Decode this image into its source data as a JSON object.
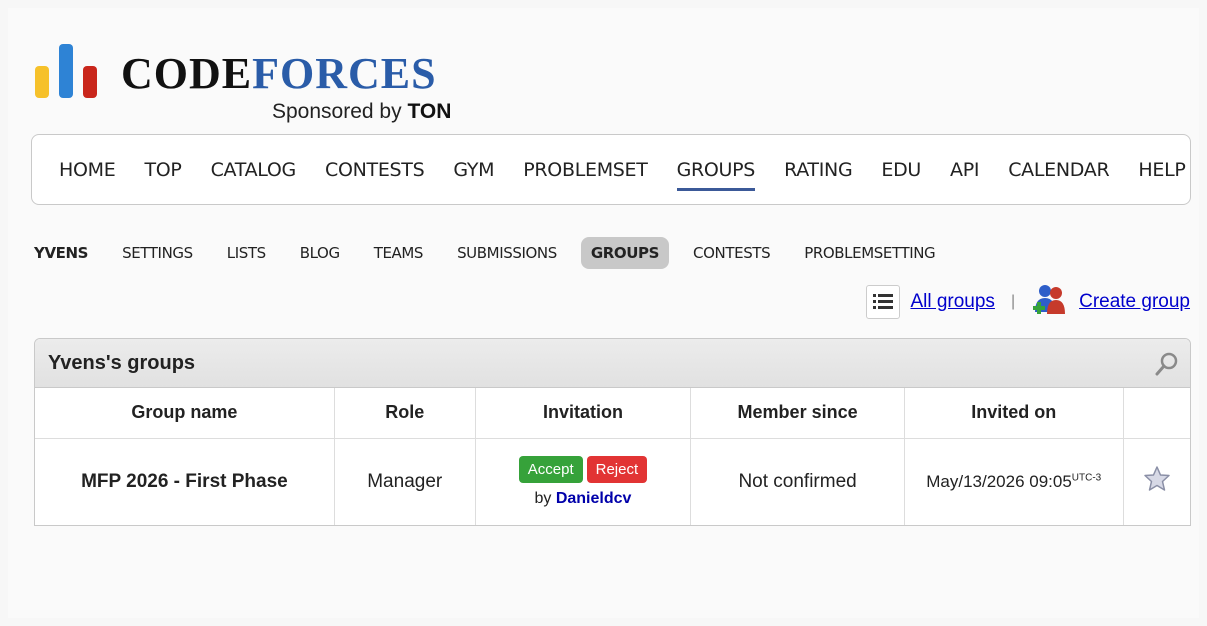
{
  "logo": {
    "code": "CODE",
    "forces": "FORCES",
    "sponsor_prefix": "Sponsored by",
    "sponsor_name": "TON",
    "colors": {
      "bar1": "#f6c12a",
      "bar2": "#2e83d5",
      "bar3": "#c9261b",
      "forces": "#2a5ca8"
    }
  },
  "main_menu": [
    "HOME",
    "TOP",
    "CATALOG",
    "CONTESTS",
    "GYM",
    "PROBLEMSET",
    "GROUPS",
    "RATING",
    "EDU",
    "API",
    "CALENDAR",
    "HELP"
  ],
  "second_menu": [
    "YVENS",
    "SETTINGS",
    "LISTS",
    "BLOG",
    "TEAMS",
    "SUBMISSIONS",
    "GROUPS",
    "CONTESTS",
    "PROBLEMSETTING"
  ],
  "links": {
    "all_groups": "All groups",
    "separator": "|",
    "create_group": "Create group"
  },
  "box": {
    "title": "Yvens's groups"
  },
  "table": {
    "headers": [
      "Group name",
      "Role",
      "Invitation",
      "Member since",
      "Invited on"
    ],
    "rows": [
      {
        "name": "MFP 2026 - First Phase",
        "role": "Manager",
        "accept": "Accept",
        "reject": "Reject",
        "by": "by",
        "by_user": "Danieldcv",
        "member_since": "Not confirmed",
        "invited_on": "May/13/2026 09:05",
        "tz": "UTC-3"
      }
    ]
  }
}
